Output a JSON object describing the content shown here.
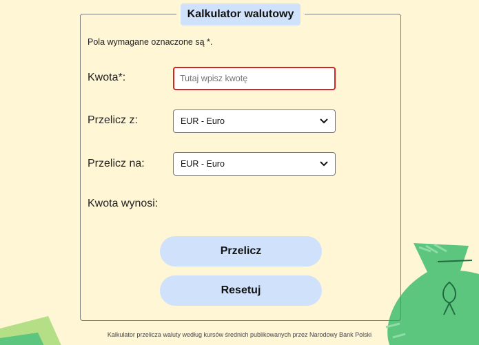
{
  "form": {
    "title": "Kalkulator walutowy",
    "required_note": "Pola wymagane oznaczone są *.",
    "amount_label": "Kwota*:",
    "amount_placeholder": "Tutaj wpisz kwotę",
    "amount_value": "",
    "from_label": "Przelicz z:",
    "from_selected": "EUR - Euro",
    "to_label": "Przelicz na:",
    "to_selected": "EUR - Euro",
    "result_label": "Kwota wynosi:",
    "result_value": "",
    "calculate_button": "Przelicz",
    "reset_button": "Resetuj"
  },
  "footer": {
    "text": "Kalkulator przelicza waluty według kursów średnich publikowanych przez Narodowy Bank Polski"
  },
  "colors": {
    "background": "#fff6d6",
    "accent": "#cfe1fb",
    "error_border": "#d42424",
    "decoration_green": "#5cc57e"
  },
  "icons": {
    "select_arrow": "chevron-down-icon",
    "decoration_left": "banknote-illustration",
    "decoration_right": "money-bag-illustration"
  }
}
